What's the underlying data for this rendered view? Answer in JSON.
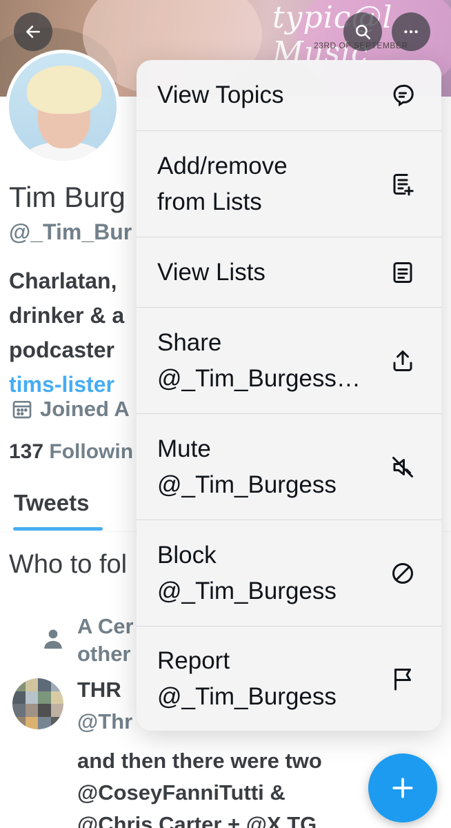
{
  "banner": {
    "logo_text": "typic@l Music",
    "date_text": "23RD OF SEPTEMBER"
  },
  "header": {
    "back_icon": "arrow-left-icon",
    "search_icon": "search-icon",
    "more_icon": "more-horizontal-icon"
  },
  "profile": {
    "name": "Tim Burg",
    "handle": "@_Tim_Bur",
    "bio_lines": [
      "Charlatan,",
      "drinker & a",
      "podcaster"
    ],
    "link": "tims-lister",
    "joined": "Joined A",
    "following_count": "137",
    "following_label": "Followin"
  },
  "tabs": {
    "active": "Tweets"
  },
  "who_to_follow": {
    "title": "Who to fol",
    "context_lines": [
      "A Cer",
      "other"
    ],
    "suggestion": {
      "name": "THR",
      "handle": "@Thr",
      "bio_lines": [
        "and then there were two",
        "@CoseyFanniTutti &",
        "@Chris Carter + @X TG"
      ]
    }
  },
  "menu": {
    "items": [
      {
        "label": "View Topics",
        "icon": "topics-icon"
      },
      {
        "label": "Add/remove\nfrom Lists",
        "icon": "list-add-icon"
      },
      {
        "label": "View Lists",
        "icon": "list-icon"
      },
      {
        "label": "Share\n@_Tim_Burgess…",
        "icon": "share-icon"
      },
      {
        "label": "Mute\n@_Tim_Burgess",
        "icon": "mute-icon"
      },
      {
        "label": "Block\n@_Tim_Burgess",
        "icon": "block-icon"
      },
      {
        "label": "Report\n@_Tim_Burgess",
        "icon": "flag-icon"
      }
    ]
  },
  "fab": {
    "icon": "plus-icon"
  },
  "colors": {
    "accent": "#1d9bf0",
    "text_primary": "#0f1419",
    "text_secondary": "#536471",
    "menu_background": "#f4f4f5"
  }
}
